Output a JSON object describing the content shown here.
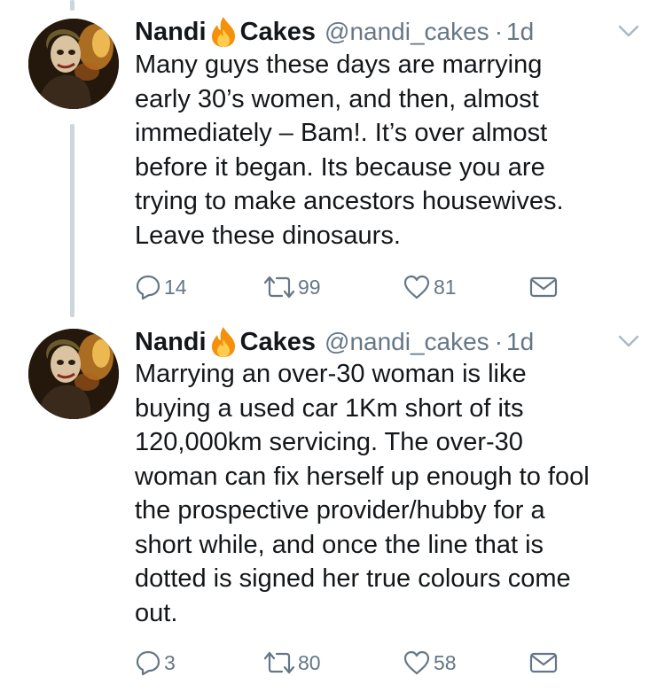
{
  "colors": {
    "text": "#14171a",
    "secondary": "#657786",
    "thread_line": "#ccd6dd"
  },
  "tweets": [
    {
      "author": {
        "name_first": "Nandi",
        "name_emoji": "fire-emoji",
        "name_last": "Cakes",
        "handle": "@nandi_cakes"
      },
      "separator": "·",
      "time": "1d",
      "lines": [
        "Many guys these days are marrying",
        "early 30’s women, and then, almost",
        "immediately – Bam!. It’s over almost",
        "before it began. Its because you are",
        "trying to make ancestors housewives.",
        "Leave these dinosaurs."
      ],
      "replies": "14",
      "retweets": "99",
      "likes": "81"
    },
    {
      "author": {
        "name_first": "Nandi",
        "name_emoji": "fire-emoji",
        "name_last": "Cakes",
        "handle": "@nandi_cakes"
      },
      "separator": "·",
      "time": "1d",
      "lines": [
        "Marrying an over-30 woman is like",
        "buying a used car 1Km short of its",
        "120,000km servicing. The over-30",
        "woman can fix herself up enough to fool",
        "the prospective provider/hubby for a",
        "short while, and once the line that is",
        "dotted is signed her true colours come",
        "out."
      ],
      "replies": "3",
      "retweets": "80",
      "likes": "58"
    }
  ]
}
